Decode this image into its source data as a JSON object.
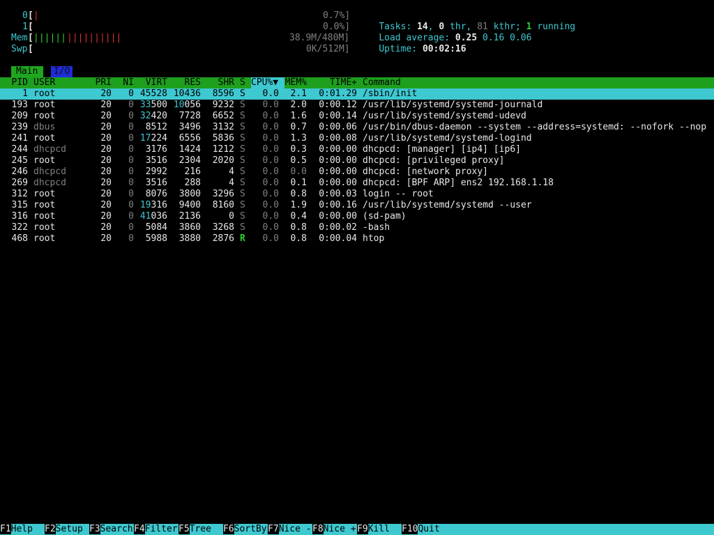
{
  "meters": {
    "cpu0": {
      "label": "0",
      "open": "[",
      "bar": "|",
      "value": "0.7%]"
    },
    "cpu1": {
      "label": "1",
      "open": "[",
      "bar": "",
      "value": "0.0%]"
    },
    "mem": {
      "label": "Mem",
      "open": "[",
      "bar_green": "||||||",
      "bar_red": "||||||||||",
      "value": "38.9M/480M]"
    },
    "swp": {
      "label": "Swp",
      "open": "[",
      "bar": "",
      "value": "0K/512M]"
    }
  },
  "summary": {
    "tasks_label": "Tasks: ",
    "tasks": "14",
    "sep1": ", ",
    "thr": "0",
    "thr_label": " thr, ",
    "kthr": "81",
    "kthr_label": " kthr; ",
    "running": "1",
    "running_label": " running",
    "load_label": "Load average: ",
    "load1": "0.25",
    "load5": "0.16",
    "load15": "0.06",
    "uptime_label": "Uptime: ",
    "uptime": "00:02:16"
  },
  "tabs": {
    "main": "Main",
    "io": "I/O"
  },
  "columns": {
    "pid": "PID",
    "user": "USER",
    "pri": "PRI",
    "ni": "NI",
    "virt": "VIRT",
    "res": "RES",
    "shr": "SHR",
    "s": "S",
    "cpu": "CPU%▼",
    "mem": "MEM%",
    "time": "TIME+",
    "command": "Command"
  },
  "processes": [
    {
      "pid": "1",
      "user": "root",
      "pri": "20",
      "ni": "0",
      "virt": "45528",
      "res": "10436",
      "shr": "8596",
      "s": "S",
      "cpu": "0.0",
      "mem": "2.1",
      "time": "0:01.29",
      "command": "/sbin/init"
    },
    {
      "pid": "193",
      "user": "root",
      "pri": "20",
      "ni": "0",
      "virt": "33500",
      "res": "10056",
      "shr": "9232",
      "s": "S",
      "cpu": "0.0",
      "mem": "2.0",
      "time": "0:00.12",
      "command": "/usr/lib/systemd/systemd-journald"
    },
    {
      "pid": "209",
      "user": "root",
      "pri": "20",
      "ni": "0",
      "virt": "32420",
      "res": "7728",
      "shr": "6652",
      "s": "S",
      "cpu": "0.0",
      "mem": "1.6",
      "time": "0:00.14",
      "command": "/usr/lib/systemd/systemd-udevd"
    },
    {
      "pid": "239",
      "user": "dbus",
      "pri": "20",
      "ni": "0",
      "virt": "8512",
      "res": "3496",
      "shr": "3132",
      "s": "S",
      "cpu": "0.0",
      "mem": "0.7",
      "time": "0:00.06",
      "command": "/usr/bin/dbus-daemon --system --address=systemd: --nofork --nop"
    },
    {
      "pid": "241",
      "user": "root",
      "pri": "20",
      "ni": "0",
      "virt": "17224",
      "res": "6556",
      "shr": "5836",
      "s": "S",
      "cpu": "0.0",
      "mem": "1.3",
      "time": "0:00.08",
      "command": "/usr/lib/systemd/systemd-logind"
    },
    {
      "pid": "244",
      "user": "dhcpcd",
      "pri": "20",
      "ni": "0",
      "virt": "3176",
      "res": "1424",
      "shr": "1212",
      "s": "S",
      "cpu": "0.0",
      "mem": "0.3",
      "time": "0:00.00",
      "command": "dhcpcd: [manager] [ip4] [ip6]"
    },
    {
      "pid": "245",
      "user": "root",
      "pri": "20",
      "ni": "0",
      "virt": "3516",
      "res": "2304",
      "shr": "2020",
      "s": "S",
      "cpu": "0.0",
      "mem": "0.5",
      "time": "0:00.00",
      "command": "dhcpcd: [privileged proxy]"
    },
    {
      "pid": "246",
      "user": "dhcpcd",
      "pri": "20",
      "ni": "0",
      "virt": "2992",
      "res": "216",
      "shr": "4",
      "s": "S",
      "cpu": "0.0",
      "mem": "0.0",
      "time": "0:00.00",
      "command": "dhcpcd: [network proxy]"
    },
    {
      "pid": "269",
      "user": "dhcpcd",
      "pri": "20",
      "ni": "0",
      "virt": "3516",
      "res": "288",
      "shr": "4",
      "s": "S",
      "cpu": "0.0",
      "mem": "0.1",
      "time": "0:00.00",
      "command": "dhcpcd: [BPF ARP] ens2 192.168.1.18"
    },
    {
      "pid": "312",
      "user": "root",
      "pri": "20",
      "ni": "0",
      "virt": "8076",
      "res": "3800",
      "shr": "3296",
      "s": "S",
      "cpu": "0.0",
      "mem": "0.8",
      "time": "0:00.03",
      "command": "login -- root"
    },
    {
      "pid": "315",
      "user": "root",
      "pri": "20",
      "ni": "0",
      "virt": "19316",
      "res": "9400",
      "shr": "8160",
      "s": "S",
      "cpu": "0.0",
      "mem": "1.9",
      "time": "0:00.16",
      "command": "/usr/lib/systemd/systemd --user"
    },
    {
      "pid": "316",
      "user": "root",
      "pri": "20",
      "ni": "0",
      "virt": "41036",
      "res": "2136",
      "shr": "0",
      "s": "S",
      "cpu": "0.0",
      "mem": "0.4",
      "time": "0:00.00",
      "command": "(sd-pam)"
    },
    {
      "pid": "322",
      "user": "root",
      "pri": "20",
      "ni": "0",
      "virt": "5084",
      "res": "3860",
      "shr": "3268",
      "s": "S",
      "cpu": "0.0",
      "mem": "0.8",
      "time": "0:00.02",
      "command": "-bash"
    },
    {
      "pid": "468",
      "user": "root",
      "pri": "20",
      "ni": "0",
      "virt": "5988",
      "res": "3880",
      "shr": "2876",
      "s": "R",
      "cpu": "0.0",
      "mem": "0.8",
      "time": "0:00.04",
      "command": "htop"
    }
  ],
  "footer": [
    {
      "key": "F1",
      "label": "Help"
    },
    {
      "key": "F2",
      "label": "Setup"
    },
    {
      "key": "F3",
      "label": "Search"
    },
    {
      "key": "F4",
      "label": "Filter"
    },
    {
      "key": "F5",
      "label": "Tree"
    },
    {
      "key": "F6",
      "label": "SortBy"
    },
    {
      "key": "F7",
      "label": "Nice -"
    },
    {
      "key": "F8",
      "label": "Nice +"
    },
    {
      "key": "F9",
      "label": "Kill"
    },
    {
      "key": "F10",
      "label": "Quit"
    }
  ],
  "colors": {
    "cyan": "#3ec8d0",
    "green": "#1ea01e",
    "red": "#e03030",
    "background": "#000000"
  }
}
